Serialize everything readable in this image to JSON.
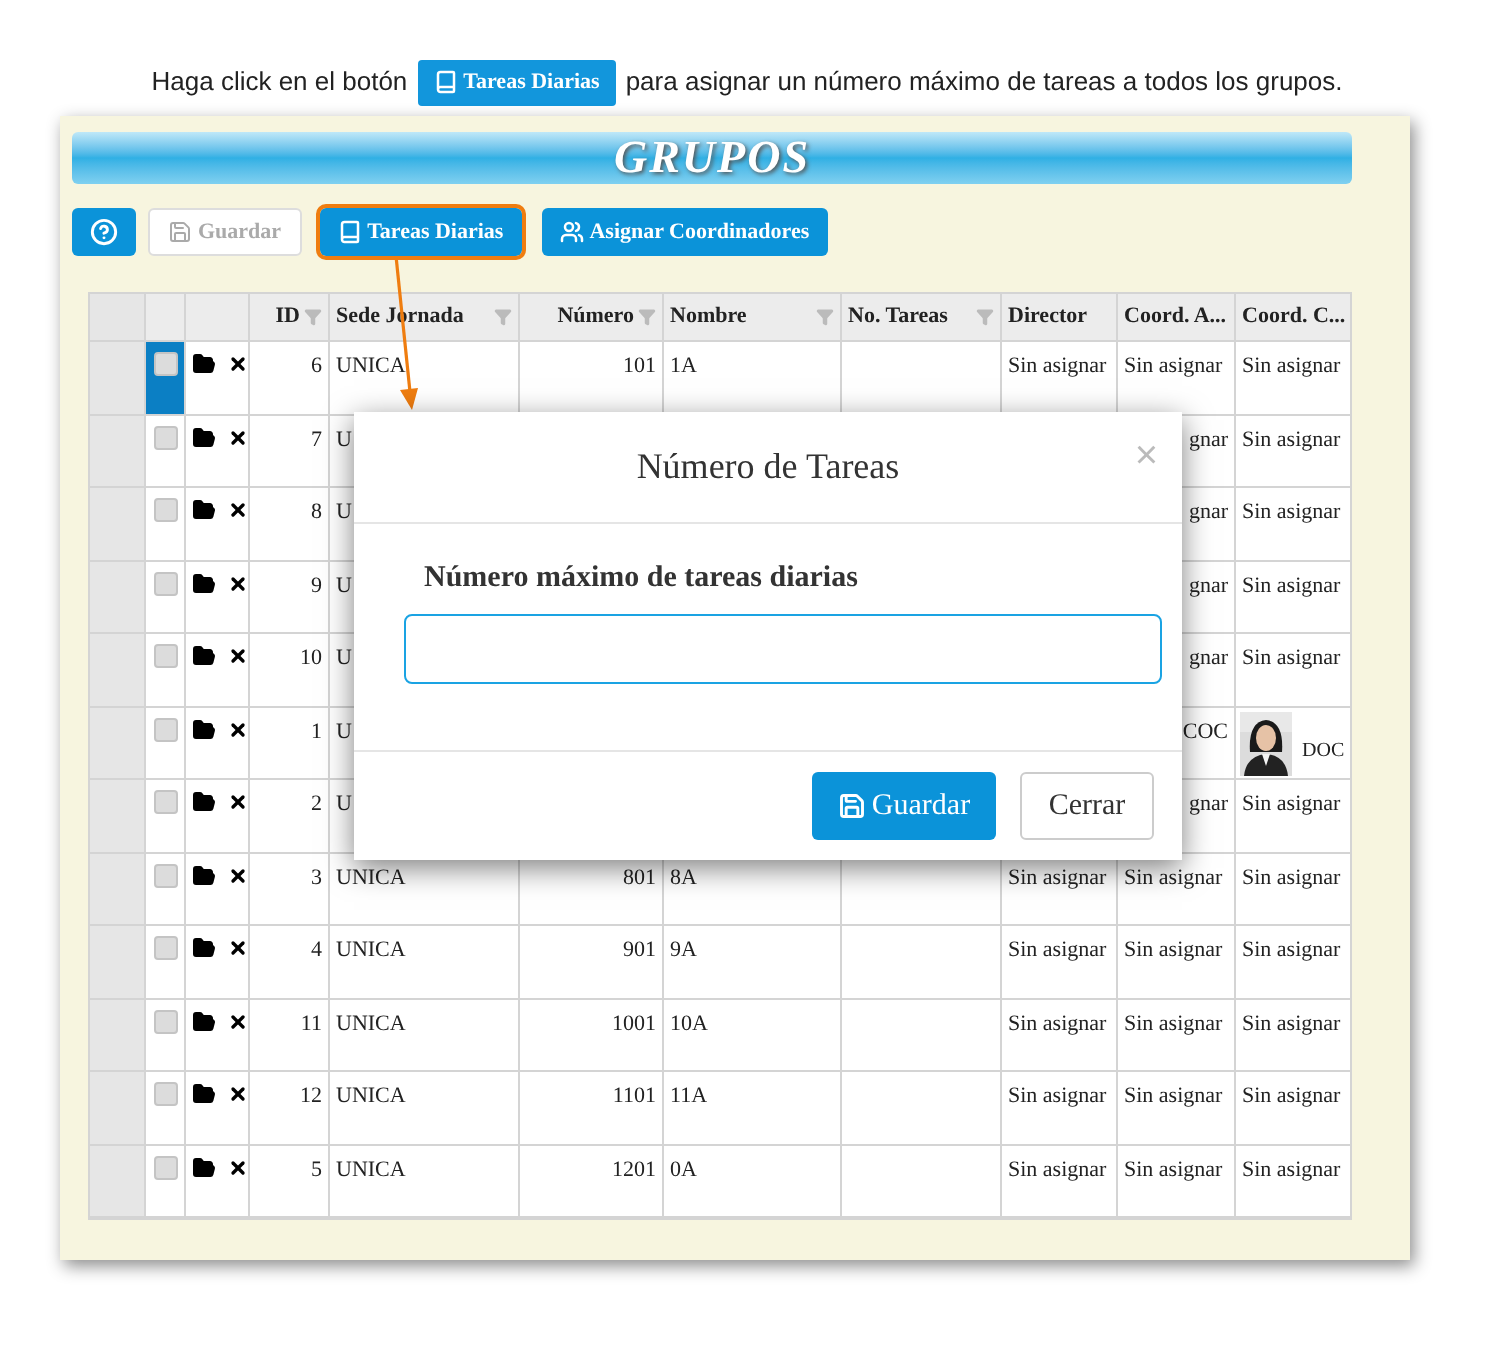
{
  "caption": {
    "before": "Haga click en el botón",
    "button": "Tareas Diarias",
    "after": "para asignar un número máximo de tareas a todos los grupos."
  },
  "title": "GRUPOS",
  "toolbar": [
    {
      "kind": "help",
      "disabled": false,
      "highlighted": false
    },
    {
      "kind": "save",
      "label": "Guardar",
      "disabled": true,
      "highlighted": false
    },
    {
      "kind": "tasks",
      "label": "Tareas Diarias",
      "disabled": false,
      "highlighted": true
    },
    {
      "kind": "coordinators",
      "label": "Asignar Coordinadores",
      "disabled": false,
      "highlighted": false
    }
  ],
  "table": {
    "columns": [
      {
        "label": "ID",
        "filter": true,
        "kind": "number"
      },
      {
        "label": "Sede Jornada",
        "filter": true,
        "kind": "text"
      },
      {
        "label": "Número",
        "filter": true,
        "kind": "number"
      },
      {
        "label": "Nombre",
        "filter": true,
        "kind": "text"
      },
      {
        "label": "No. Tareas",
        "filter": true,
        "kind": "text"
      },
      {
        "label": "Director",
        "filter": false,
        "kind": "text"
      },
      {
        "label": "Coord. A...",
        "filter": false,
        "kind": "text"
      },
      {
        "label": "Coord. C...",
        "filter": false,
        "kind": "text"
      }
    ],
    "rows": [
      {
        "selected": true,
        "covered": false,
        "cells": [
          "6",
          "UNICA",
          "101",
          "1A",
          "",
          "Sin asignar",
          "Sin asignar",
          "Sin asignar"
        ]
      },
      {
        "selected": false,
        "covered": true,
        "cells": [
          "7",
          "U",
          "",
          "",
          "",
          "",
          "gnar",
          "Sin asignar"
        ]
      },
      {
        "selected": false,
        "covered": true,
        "cells": [
          "8",
          "U",
          "",
          "",
          "",
          "",
          "gnar",
          "Sin asignar"
        ]
      },
      {
        "selected": false,
        "covered": true,
        "cells": [
          "9",
          "U",
          "",
          "",
          "",
          "",
          "gnar",
          "Sin asignar"
        ]
      },
      {
        "selected": false,
        "covered": true,
        "cells": [
          "10",
          "U",
          "",
          "",
          "",
          "",
          "gnar",
          "Sin asignar"
        ]
      },
      {
        "selected": false,
        "covered": true,
        "photo": true,
        "cells": [
          "1",
          "U",
          "",
          "",
          "",
          "",
          "COC",
          "DOC"
        ]
      },
      {
        "selected": false,
        "covered": true,
        "cells": [
          "2",
          "U",
          "",
          "",
          "",
          "",
          "gnar",
          "Sin asignar"
        ]
      },
      {
        "selected": false,
        "covered": false,
        "cells": [
          "3",
          "UNICA",
          "801",
          "8A",
          "",
          "Sin asignar",
          "Sin asignar",
          "Sin asignar"
        ]
      },
      {
        "selected": false,
        "covered": false,
        "cells": [
          "4",
          "UNICA",
          "901",
          "9A",
          "",
          "Sin asignar",
          "Sin asignar",
          "Sin asignar"
        ]
      },
      {
        "selected": false,
        "covered": false,
        "cells": [
          "11",
          "UNICA",
          "1001",
          "10A",
          "",
          "Sin asignar",
          "Sin asignar",
          "Sin asignar"
        ]
      },
      {
        "selected": false,
        "covered": false,
        "cells": [
          "12",
          "UNICA",
          "1101",
          "11A",
          "",
          "Sin asignar",
          "Sin asignar",
          "Sin asignar"
        ]
      },
      {
        "selected": false,
        "covered": false,
        "cells": [
          "5",
          "UNICA",
          "1201",
          "0A",
          "",
          "Sin asignar",
          "Sin asignar",
          "Sin asignar"
        ]
      }
    ]
  },
  "modal": {
    "title": "Número de Tareas",
    "close": "×",
    "label": "Número máximo de tareas diarias",
    "buttons": [
      {
        "kind": "primary",
        "label": "Guardar"
      },
      {
        "kind": "secondary",
        "label": "Cerrar"
      }
    ]
  }
}
